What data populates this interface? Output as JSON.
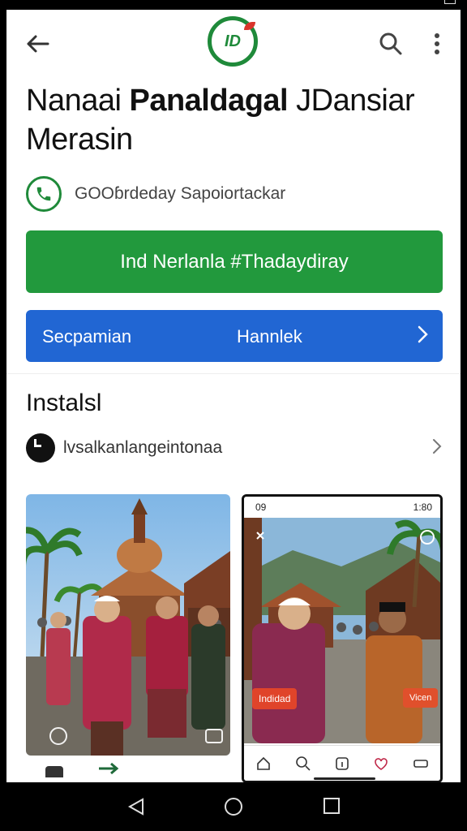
{
  "app": {
    "title_part1": "Nanaai ",
    "title_bold": "Panaldagal",
    "title_part2": " JDansiar Merasin",
    "publisher": "GOOɓrdeday Sapoiortackar"
  },
  "buttons": {
    "install_label": "Ind Nerlanla #Thadaydiray",
    "secondary_left": "Secpamian",
    "secondary_center": "Hannlek"
  },
  "section": {
    "heading": "Instalsl",
    "info_row": "lvsalkanlangeintonaa"
  },
  "screenshot2": {
    "time": "09",
    "status_right": "1:80",
    "tag_left": "Indidad",
    "tag_right": "Vicen"
  },
  "icons": [
    "back-arrow-icon",
    "app-logo-icon",
    "search-icon",
    "more-vert-icon",
    "phone-icon",
    "chevron-right-icon",
    "clock-icon",
    "home-icon",
    "search-icon",
    "info-icon",
    "heart-icon",
    "menu-icon"
  ],
  "colors": {
    "green": "#22993d",
    "blue": "#2166d3",
    "logo_green": "#1f8a3a"
  }
}
